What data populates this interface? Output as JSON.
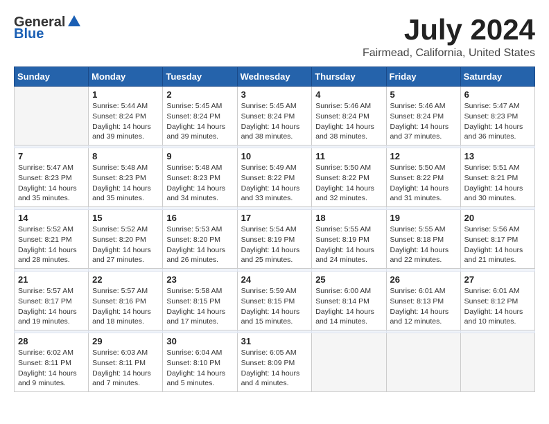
{
  "header": {
    "logo_general": "General",
    "logo_blue": "Blue",
    "month": "July 2024",
    "location": "Fairmead, California, United States"
  },
  "weekdays": [
    "Sunday",
    "Monday",
    "Tuesday",
    "Wednesday",
    "Thursday",
    "Friday",
    "Saturday"
  ],
  "weeks": [
    [
      {
        "day": "",
        "info": ""
      },
      {
        "day": "1",
        "info": "Sunrise: 5:44 AM\nSunset: 8:24 PM\nDaylight: 14 hours\nand 39 minutes."
      },
      {
        "day": "2",
        "info": "Sunrise: 5:45 AM\nSunset: 8:24 PM\nDaylight: 14 hours\nand 39 minutes."
      },
      {
        "day": "3",
        "info": "Sunrise: 5:45 AM\nSunset: 8:24 PM\nDaylight: 14 hours\nand 38 minutes."
      },
      {
        "day": "4",
        "info": "Sunrise: 5:46 AM\nSunset: 8:24 PM\nDaylight: 14 hours\nand 38 minutes."
      },
      {
        "day": "5",
        "info": "Sunrise: 5:46 AM\nSunset: 8:24 PM\nDaylight: 14 hours\nand 37 minutes."
      },
      {
        "day": "6",
        "info": "Sunrise: 5:47 AM\nSunset: 8:23 PM\nDaylight: 14 hours\nand 36 minutes."
      }
    ],
    [
      {
        "day": "7",
        "info": "Sunrise: 5:47 AM\nSunset: 8:23 PM\nDaylight: 14 hours\nand 35 minutes."
      },
      {
        "day": "8",
        "info": "Sunrise: 5:48 AM\nSunset: 8:23 PM\nDaylight: 14 hours\nand 35 minutes."
      },
      {
        "day": "9",
        "info": "Sunrise: 5:48 AM\nSunset: 8:23 PM\nDaylight: 14 hours\nand 34 minutes."
      },
      {
        "day": "10",
        "info": "Sunrise: 5:49 AM\nSunset: 8:22 PM\nDaylight: 14 hours\nand 33 minutes."
      },
      {
        "day": "11",
        "info": "Sunrise: 5:50 AM\nSunset: 8:22 PM\nDaylight: 14 hours\nand 32 minutes."
      },
      {
        "day": "12",
        "info": "Sunrise: 5:50 AM\nSunset: 8:22 PM\nDaylight: 14 hours\nand 31 minutes."
      },
      {
        "day": "13",
        "info": "Sunrise: 5:51 AM\nSunset: 8:21 PM\nDaylight: 14 hours\nand 30 minutes."
      }
    ],
    [
      {
        "day": "14",
        "info": "Sunrise: 5:52 AM\nSunset: 8:21 PM\nDaylight: 14 hours\nand 28 minutes."
      },
      {
        "day": "15",
        "info": "Sunrise: 5:52 AM\nSunset: 8:20 PM\nDaylight: 14 hours\nand 27 minutes."
      },
      {
        "day": "16",
        "info": "Sunrise: 5:53 AM\nSunset: 8:20 PM\nDaylight: 14 hours\nand 26 minutes."
      },
      {
        "day": "17",
        "info": "Sunrise: 5:54 AM\nSunset: 8:19 PM\nDaylight: 14 hours\nand 25 minutes."
      },
      {
        "day": "18",
        "info": "Sunrise: 5:55 AM\nSunset: 8:19 PM\nDaylight: 14 hours\nand 24 minutes."
      },
      {
        "day": "19",
        "info": "Sunrise: 5:55 AM\nSunset: 8:18 PM\nDaylight: 14 hours\nand 22 minutes."
      },
      {
        "day": "20",
        "info": "Sunrise: 5:56 AM\nSunset: 8:17 PM\nDaylight: 14 hours\nand 21 minutes."
      }
    ],
    [
      {
        "day": "21",
        "info": "Sunrise: 5:57 AM\nSunset: 8:17 PM\nDaylight: 14 hours\nand 19 minutes."
      },
      {
        "day": "22",
        "info": "Sunrise: 5:57 AM\nSunset: 8:16 PM\nDaylight: 14 hours\nand 18 minutes."
      },
      {
        "day": "23",
        "info": "Sunrise: 5:58 AM\nSunset: 8:15 PM\nDaylight: 14 hours\nand 17 minutes."
      },
      {
        "day": "24",
        "info": "Sunrise: 5:59 AM\nSunset: 8:15 PM\nDaylight: 14 hours\nand 15 minutes."
      },
      {
        "day": "25",
        "info": "Sunrise: 6:00 AM\nSunset: 8:14 PM\nDaylight: 14 hours\nand 14 minutes."
      },
      {
        "day": "26",
        "info": "Sunrise: 6:01 AM\nSunset: 8:13 PM\nDaylight: 14 hours\nand 12 minutes."
      },
      {
        "day": "27",
        "info": "Sunrise: 6:01 AM\nSunset: 8:12 PM\nDaylight: 14 hours\nand 10 minutes."
      }
    ],
    [
      {
        "day": "28",
        "info": "Sunrise: 6:02 AM\nSunset: 8:11 PM\nDaylight: 14 hours\nand 9 minutes."
      },
      {
        "day": "29",
        "info": "Sunrise: 6:03 AM\nSunset: 8:11 PM\nDaylight: 14 hours\nand 7 minutes."
      },
      {
        "day": "30",
        "info": "Sunrise: 6:04 AM\nSunset: 8:10 PM\nDaylight: 14 hours\nand 5 minutes."
      },
      {
        "day": "31",
        "info": "Sunrise: 6:05 AM\nSunset: 8:09 PM\nDaylight: 14 hours\nand 4 minutes."
      },
      {
        "day": "",
        "info": ""
      },
      {
        "day": "",
        "info": ""
      },
      {
        "day": "",
        "info": ""
      }
    ]
  ]
}
